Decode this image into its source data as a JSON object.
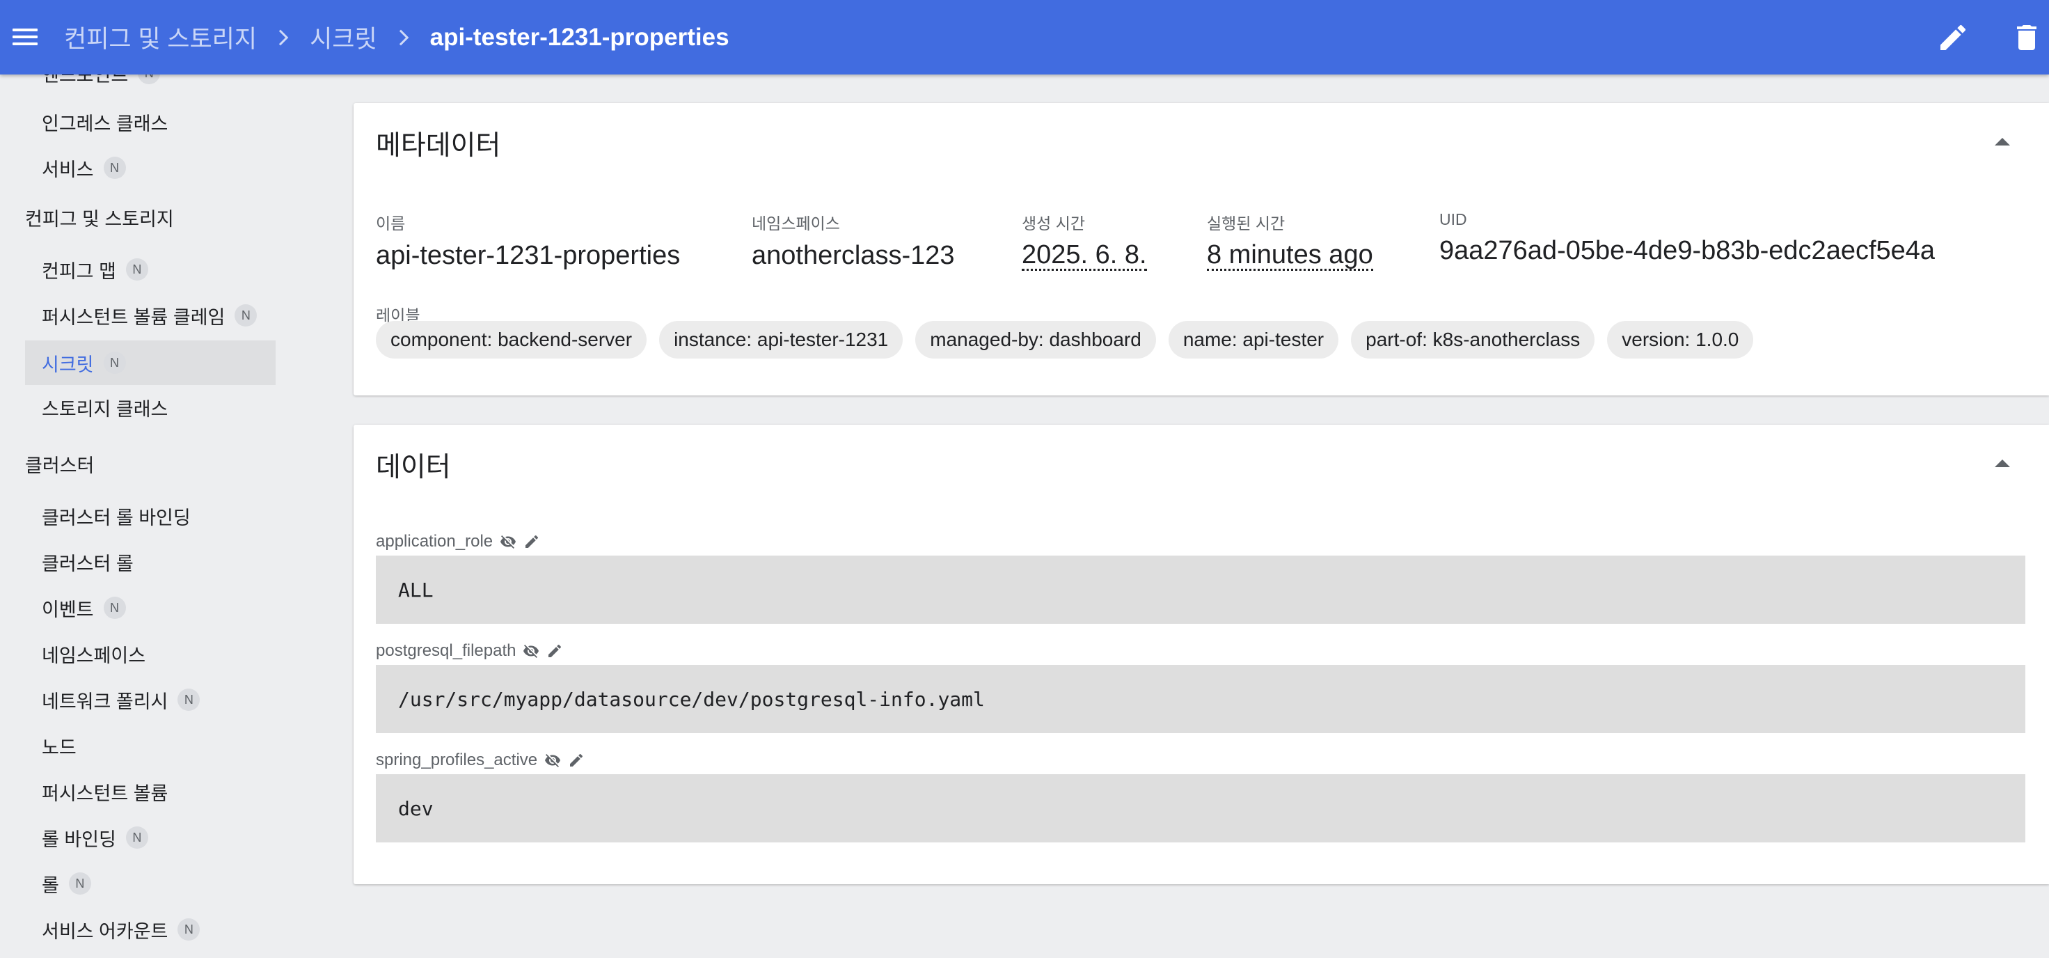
{
  "header": {
    "breadcrumbs": [
      "컨피그 및 스토리지",
      "시크릿"
    ],
    "current": "api-tester-1231-properties",
    "edit_icon": "pencil-icon",
    "delete_icon": "trash-icon",
    "bar_color": "#416ce0"
  },
  "sidebar": {
    "partial_top_label": "엔드포인트",
    "items_network": [
      {
        "label": "인그레스 클래스",
        "badge": ""
      },
      {
        "label": "서비스",
        "badge": "N"
      }
    ],
    "section_config": "컨피그 및 스토리지",
    "items_config": [
      {
        "label": "컨피그 맵",
        "badge": "N"
      },
      {
        "label": "퍼시스턴트 볼륨 클레임",
        "badge": "N"
      },
      {
        "label": "시크릿",
        "badge": "N"
      },
      {
        "label": "스토리지 클래스",
        "badge": ""
      }
    ],
    "section_cluster": "클러스터",
    "items_cluster": [
      {
        "label": "클러스터 롤 바인딩",
        "badge": ""
      },
      {
        "label": "클러스터 롤",
        "badge": ""
      },
      {
        "label": "이벤트",
        "badge": "N"
      },
      {
        "label": "네임스페이스",
        "badge": ""
      },
      {
        "label": "네트워크 폴리시",
        "badge": "N"
      },
      {
        "label": "노드",
        "badge": ""
      },
      {
        "label": "퍼시스턴트 볼륨",
        "badge": ""
      },
      {
        "label": "롤 바인딩",
        "badge": "N"
      },
      {
        "label": "롤",
        "badge": "N"
      },
      {
        "label": "서비스 어카운트",
        "badge": "N"
      }
    ],
    "active_color": "#416ce0"
  },
  "metadata": {
    "title": "메타데이터",
    "fields": [
      {
        "label": "이름",
        "value": "api-tester-1231-properties"
      },
      {
        "label": "네임스페이스",
        "value": "anotherclass-123"
      },
      {
        "label": "생성 시간",
        "value": "2025. 6. 8."
      },
      {
        "label": "실행된 시간",
        "value": "8 minutes ago"
      },
      {
        "label": "UID",
        "value": "9aa276ad-05be-4de9-b83b-edc2aecf5e4a"
      }
    ],
    "labels_title": "레이블",
    "labels": [
      "component: backend-server",
      "instance: api-tester-1231",
      "managed-by: dashboard",
      "name: api-tester",
      "part-of: k8s-anotherclass",
      "version: 1.0.0"
    ]
  },
  "data_section": {
    "title": "데이터",
    "entries": [
      {
        "key": "application_role",
        "value": "ALL"
      },
      {
        "key": "postgresql_filepath",
        "value": "/usr/src/myapp/datasource/dev/postgresql-info.yaml"
      },
      {
        "key": "spring_profiles_active",
        "value": "dev"
      }
    ],
    "icons": [
      "eye-off-icon",
      "pencil-icon"
    ]
  }
}
